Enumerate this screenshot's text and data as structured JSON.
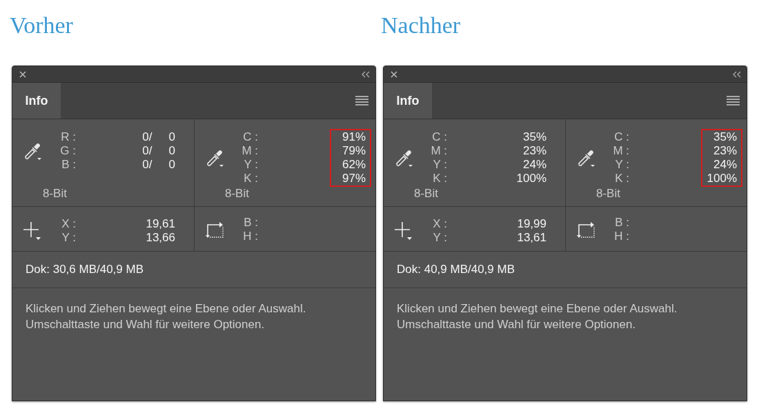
{
  "panels": [
    {
      "heading": "Vorher",
      "tab": {
        "label": "Info",
        "selected": true
      },
      "readouts": [
        {
          "kind": "sampler",
          "rows": [
            {
              "label": "R :",
              "values": [
                "0/",
                "0"
              ]
            },
            {
              "label": "G :",
              "values": [
                "0/",
                "0"
              ]
            },
            {
              "label": "B :",
              "values": [
                "0/",
                "0"
              ]
            }
          ],
          "bit_depth": "8-Bit",
          "highlighted": false
        },
        {
          "kind": "sampler",
          "rows": [
            {
              "label": "C :",
              "values": [
                "91%"
              ]
            },
            {
              "label": "M :",
              "values": [
                "79%"
              ]
            },
            {
              "label": "Y :",
              "values": [
                "62%"
              ]
            },
            {
              "label": "K :",
              "values": [
                "97%"
              ]
            }
          ],
          "bit_depth": "8-Bit",
          "highlighted": true
        }
      ],
      "position": [
        {
          "kind": "cursor",
          "rows": [
            {
              "label": "X :",
              "values": [
                "19,61"
              ]
            },
            {
              "label": "Y :",
              "values": [
                "13,66"
              ]
            }
          ]
        },
        {
          "kind": "size",
          "rows": [
            {
              "label": "B :",
              "values": []
            },
            {
              "label": "H :",
              "values": []
            }
          ]
        }
      ],
      "doc_size": "Dok: 30,6 MB/40,9 MB",
      "hint": "Klicken und Ziehen bewegt eine Ebene oder Auswahl.\nUmschalttaste und Wahl für weitere Optionen."
    },
    {
      "heading": "Nachher",
      "tab": {
        "label": "Info",
        "selected": true
      },
      "readouts": [
        {
          "kind": "sampler",
          "rows": [
            {
              "label": "C :",
              "values": [
                "35%"
              ]
            },
            {
              "label": "M :",
              "values": [
                "23%"
              ]
            },
            {
              "label": "Y :",
              "values": [
                "24%"
              ]
            },
            {
              "label": "K :",
              "values": [
                "100%"
              ]
            }
          ],
          "bit_depth": "8-Bit",
          "highlighted": false
        },
        {
          "kind": "sampler",
          "rows": [
            {
              "label": "C :",
              "values": [
                "35%"
              ]
            },
            {
              "label": "M :",
              "values": [
                "23%"
              ]
            },
            {
              "label": "Y :",
              "values": [
                "24%"
              ]
            },
            {
              "label": "K :",
              "values": [
                "100%"
              ]
            }
          ],
          "bit_depth": "8-Bit",
          "highlighted": true
        }
      ],
      "position": [
        {
          "kind": "cursor",
          "rows": [
            {
              "label": "X :",
              "values": [
                "19,99"
              ]
            },
            {
              "label": "Y :",
              "values": [
                "13,61"
              ]
            }
          ]
        },
        {
          "kind": "size",
          "rows": [
            {
              "label": "B :",
              "values": []
            },
            {
              "label": "H :",
              "values": []
            }
          ]
        }
      ],
      "doc_size": "Dok: 40,9 MB/40,9 MB",
      "hint": "Klicken und Ziehen bewegt eine Ebene oder Auswahl.\nUmschalttaste und Wahl für weitere Optionen."
    }
  ]
}
